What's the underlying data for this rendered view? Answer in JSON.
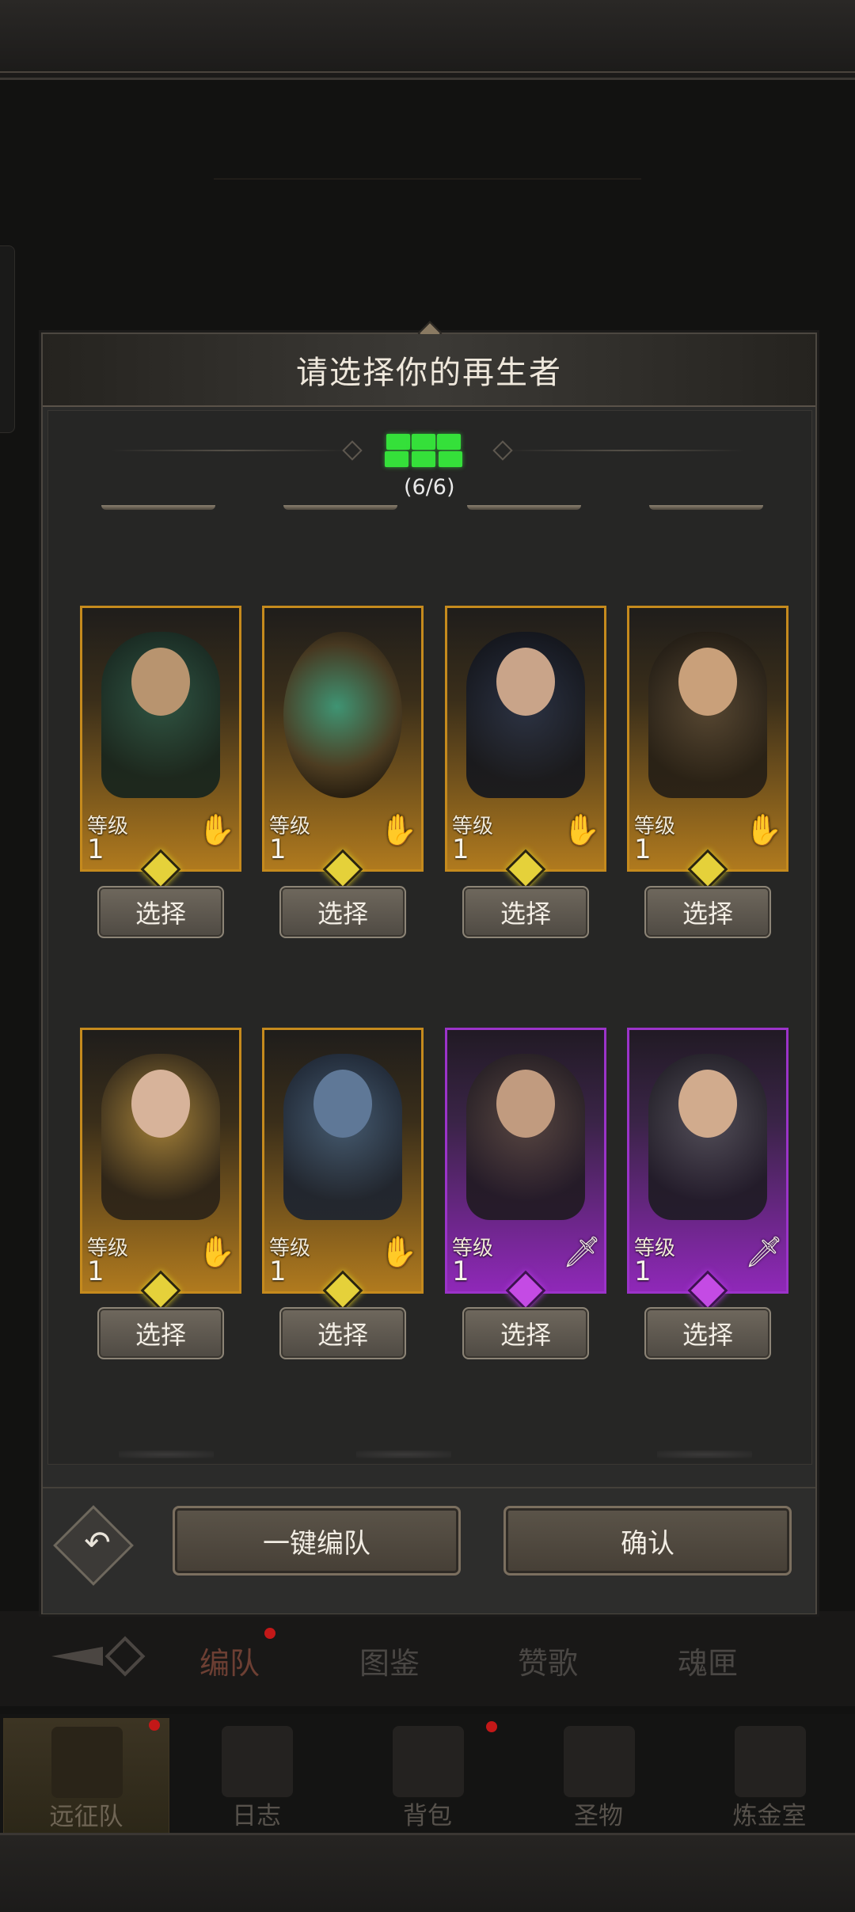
{
  "dialog": {
    "title": "请选择你的再生者",
    "count": "(6/6)",
    "footer": {
      "auto_team_label": "一键编队",
      "confirm_label": "确认"
    }
  },
  "heroes": [
    {
      "level_label": "等级",
      "level": "1",
      "rarity": "gold",
      "class_icon": "hand-icon",
      "select_label": "选择"
    },
    {
      "level_label": "等级",
      "level": "1",
      "rarity": "gold",
      "class_icon": "hand-icon",
      "select_label": "选择"
    },
    {
      "level_label": "等级",
      "level": "1",
      "rarity": "gold",
      "class_icon": "hand-icon",
      "select_label": "选择"
    },
    {
      "level_label": "等级",
      "level": "1",
      "rarity": "gold",
      "class_icon": "hand-icon",
      "select_label": "选择"
    },
    {
      "level_label": "等级",
      "level": "1",
      "rarity": "gold",
      "class_icon": "hand-icon",
      "select_label": "选择"
    },
    {
      "level_label": "等级",
      "level": "1",
      "rarity": "gold",
      "class_icon": "hand-icon",
      "select_label": "选择"
    },
    {
      "level_label": "等级",
      "level": "1",
      "rarity": "purple",
      "class_icon": "sword-icon",
      "select_label": "选择"
    },
    {
      "level_label": "等级",
      "level": "1",
      "rarity": "purple",
      "class_icon": "sword-icon",
      "select_label": "选择"
    }
  ],
  "tabs": [
    "编队",
    "图鉴",
    "赞歌",
    "魂匣"
  ],
  "bottom_nav": [
    "远征队",
    "日志",
    "背包",
    "圣物",
    "炼金室"
  ],
  "colors": {
    "gold_border": "#c58a1d",
    "purple_border": "#9b33c9",
    "count_green": "#35e03a",
    "notification_red": "#c31818"
  }
}
